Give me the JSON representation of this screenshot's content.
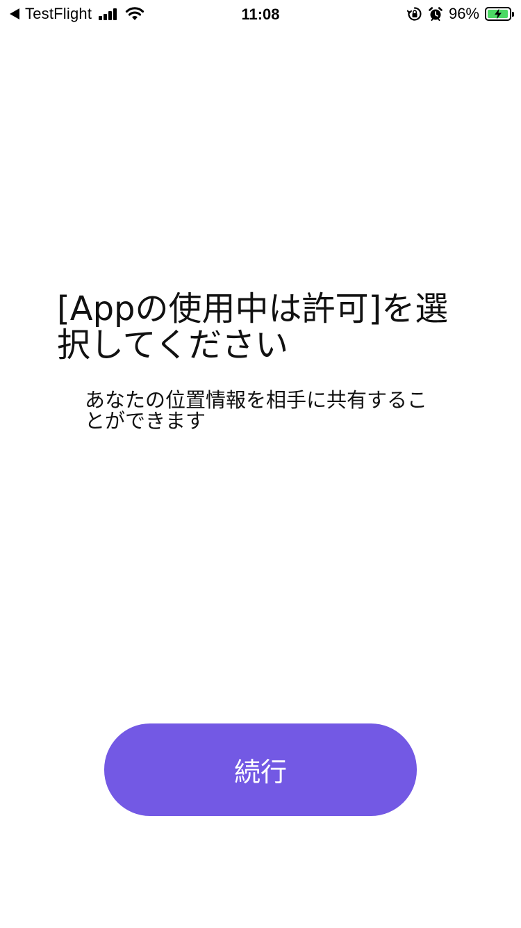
{
  "status_bar": {
    "back_app": "TestFlight",
    "time": "11:08",
    "battery_percent": "96%",
    "battery_level": 0.96,
    "battery_color": "#4cd964",
    "icons": [
      "back-arrow-icon",
      "cellular-signal-icon",
      "wifi-icon",
      "orientation-lock-icon",
      "alarm-icon",
      "battery-charging-icon"
    ]
  },
  "main": {
    "title": "[Appの使用中は許可]を選\n択してください",
    "subtitle": "あなたの位置情報を相手に共有するこ\nとができます",
    "continue_label": "続行"
  },
  "colors": {
    "accent": "#7359e4",
    "text": "#111111",
    "background": "#ffffff"
  }
}
